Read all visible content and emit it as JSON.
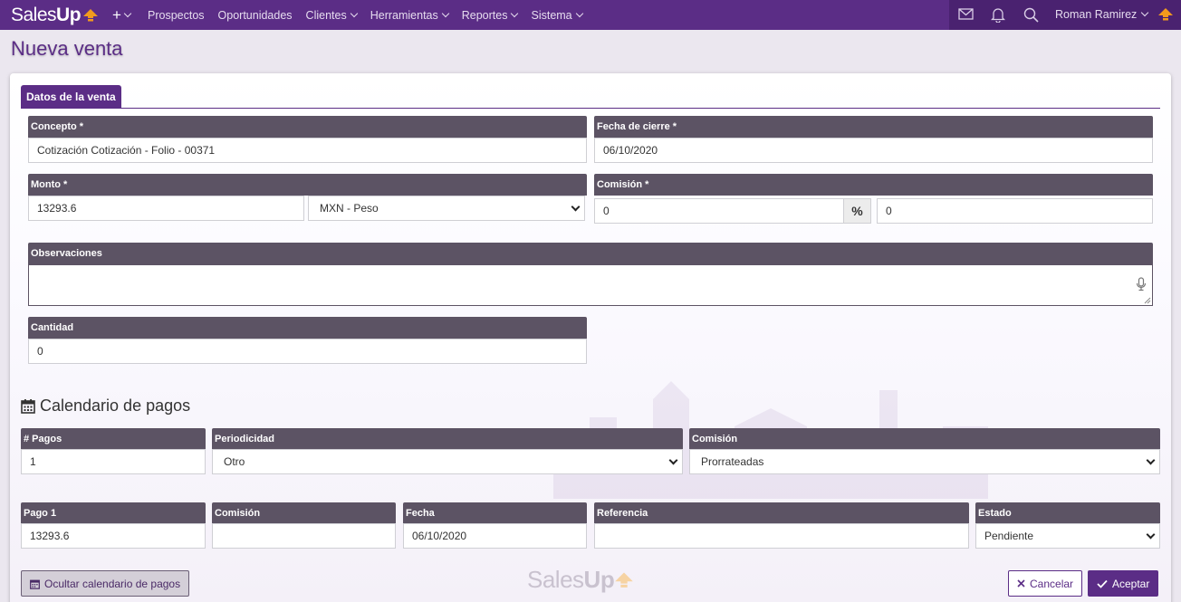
{
  "brand": {
    "logo_light": "Sales",
    "logo_bold": "Up"
  },
  "nav": {
    "plus_label": "+",
    "items": [
      "Prospectos",
      "Oportunidades",
      "Clientes",
      "Herramientas",
      "Reportes",
      "Sistema"
    ],
    "user_name": "Roman Ramirez"
  },
  "page": {
    "title": "Nueva venta",
    "tab": "Datos de la venta"
  },
  "form": {
    "concepto": {
      "label": "Concepto *",
      "value": "Cotización Cotización - Folio - 00371"
    },
    "fecha_cierre": {
      "label": "Fecha de cierre *",
      "value": "06/10/2020"
    },
    "monto": {
      "label": "Monto *",
      "value": "13293.6",
      "currency": "MXN - Peso"
    },
    "comision": {
      "label": "Comisión *",
      "percent_value": "0",
      "percent_symbol": "%",
      "amount_value": "0"
    },
    "observaciones": {
      "label": "Observaciones",
      "value": ""
    },
    "cantidad": {
      "label": "Cantidad",
      "value": "0"
    }
  },
  "calendar": {
    "title": "Calendario de pagos",
    "pagos": {
      "label": "# Pagos",
      "value": "1"
    },
    "periodicidad": {
      "label": "Periodicidad",
      "value": "Otro"
    },
    "comision": {
      "label": "Comisión",
      "value": "Prorrateadas"
    },
    "row": {
      "pago": {
        "label": "Pago 1",
        "value": "13293.6"
      },
      "comision": {
        "label": "Comisión",
        "value": ""
      },
      "fecha": {
        "label": "Fecha",
        "value": "06/10/2020"
      },
      "referencia": {
        "label": "Referencia",
        "value": ""
      },
      "estado": {
        "label": "Estado",
        "value": "Pendiente"
      }
    }
  },
  "buttons": {
    "toggle_calendar": "Ocultar calendario de pagos",
    "cancel": "Cancelar",
    "accept": "Aceptar"
  },
  "colors": {
    "brand": "#5b2d86",
    "field_header": "#5c5364",
    "logo_arrow": "#f29a1d"
  }
}
